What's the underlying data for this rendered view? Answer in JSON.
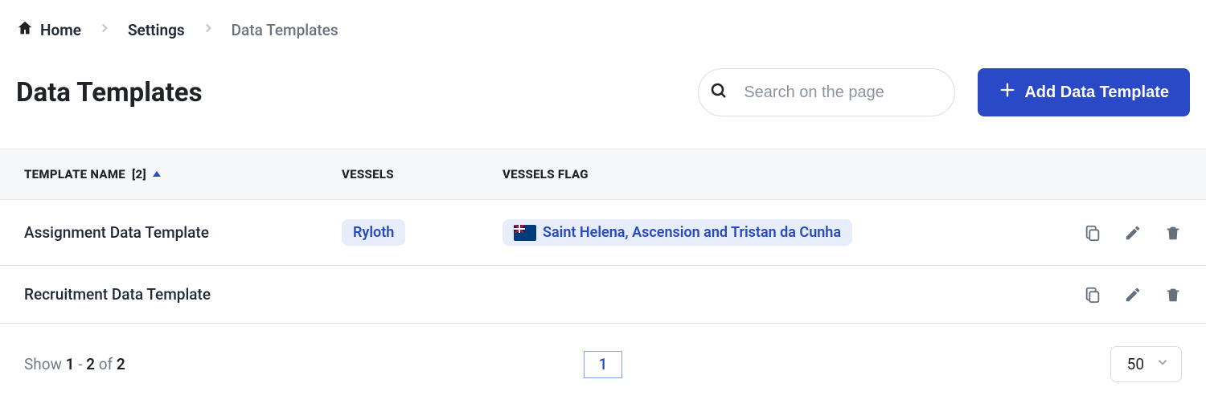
{
  "breadcrumb": {
    "home": "Home",
    "settings": "Settings",
    "current": "Data Templates"
  },
  "header": {
    "title": "Data Templates",
    "search_placeholder": "Search on the page",
    "add_button": "Add Data Template"
  },
  "table": {
    "columns": {
      "name_label": "TEMPLATE NAME",
      "name_count": "[2]",
      "vessels": "VESSELS",
      "flag": "VESSELS FLAG"
    },
    "rows": [
      {
        "name": "Assignment Data Template",
        "vessel": "Ryloth",
        "flag": "Saint Helena, Ascension and Tristan da Cunha"
      },
      {
        "name": "Recruitment Data Template",
        "vessel": "",
        "flag": ""
      }
    ]
  },
  "footer": {
    "show_pre": "Show ",
    "range_from": "1",
    "dash": " - ",
    "range_to": "2",
    "of": " of ",
    "total": "2",
    "page": "1",
    "per_page": "50"
  }
}
